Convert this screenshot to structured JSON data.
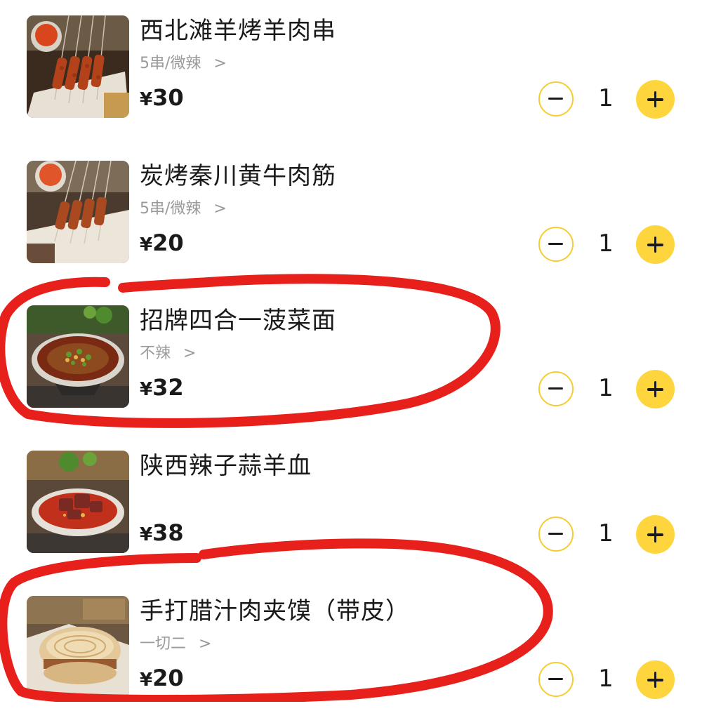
{
  "currency": "¥",
  "accent_colors": {
    "plus_button": "#ffd53d",
    "minus_border": "#f5cd33",
    "annotation": "#e8201c"
  },
  "icons": {
    "minus": "minus-icon",
    "plus": "plus-icon",
    "chevron": "chevron-right-icon"
  },
  "menu": {
    "items": [
      {
        "name": "西北滩羊烤羊肉串",
        "spec": "5串/微辣",
        "price": "30",
        "qty": "1"
      },
      {
        "name": "炭烤秦川黄牛肉筋",
        "spec": "5串/微辣",
        "price": "20",
        "qty": "1"
      },
      {
        "name": "招牌四合一菠菜面",
        "spec": "不辣",
        "price": "32",
        "qty": "1"
      },
      {
        "name": "陕西辣子蒜羊血",
        "spec": "",
        "price": "38",
        "qty": "1"
      },
      {
        "name": "手打腊汁肉夹馍（带皮）",
        "spec": "一切二",
        "price": "20",
        "qty": "1"
      }
    ]
  }
}
